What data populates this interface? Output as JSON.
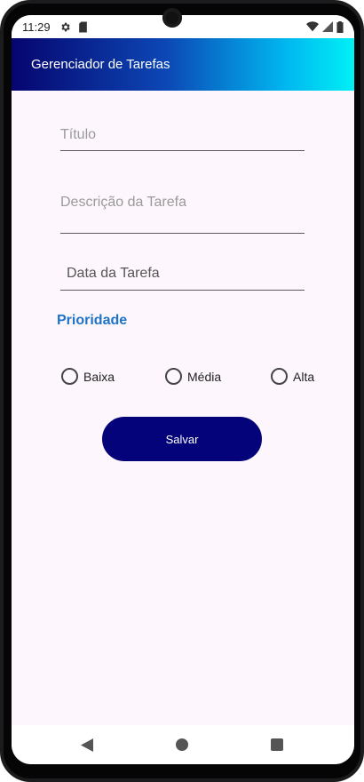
{
  "status_bar": {
    "time": "11:29",
    "icons_left": [
      "gear-icon",
      "sd-card-icon"
    ],
    "icons_right": [
      "wifi-icon",
      "signal-icon",
      "battery-icon"
    ]
  },
  "app_bar": {
    "title": "Gerenciador de Tarefas",
    "gradient": [
      "#06056f",
      "#00f0f5"
    ]
  },
  "form": {
    "title_placeholder": "Título",
    "description_placeholder": "Descrição da Tarefa",
    "date_placeholder": "Data da Tarefa",
    "priority_label": "Prioridade",
    "priority_options": [
      "Baixa",
      "Média",
      "Alta"
    ],
    "save_label": "Salvar"
  },
  "nav_bar": {
    "icons": [
      "back-icon",
      "home-icon",
      "recents-icon"
    ]
  },
  "colors": {
    "accent": "#1f73c6",
    "button": "#04037a",
    "background": "#fdf7fd"
  }
}
